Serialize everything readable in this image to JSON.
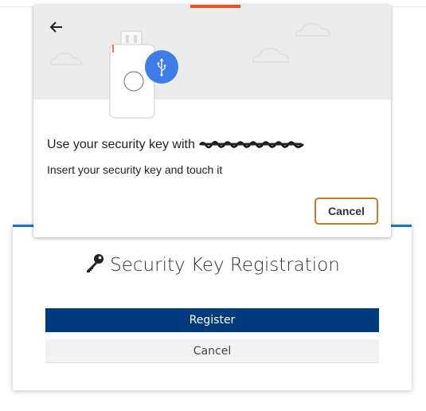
{
  "dialog": {
    "title": "Use your security key with",
    "message": "Insert your security key and touch it",
    "cancel_label": "Cancel",
    "accent_color": "#e95420",
    "button_border_color": "#c8782a",
    "icons": {
      "back": "arrow-left-icon",
      "illustration": "usb-security-key-illustration",
      "usb": "usb-icon"
    }
  },
  "registration": {
    "title": "Security Key Registration",
    "title_icon": "key-icon",
    "register_label": "Register",
    "cancel_label": "Cancel",
    "primary_color": "#003b7d",
    "top_border_color": "#1a73c7"
  }
}
